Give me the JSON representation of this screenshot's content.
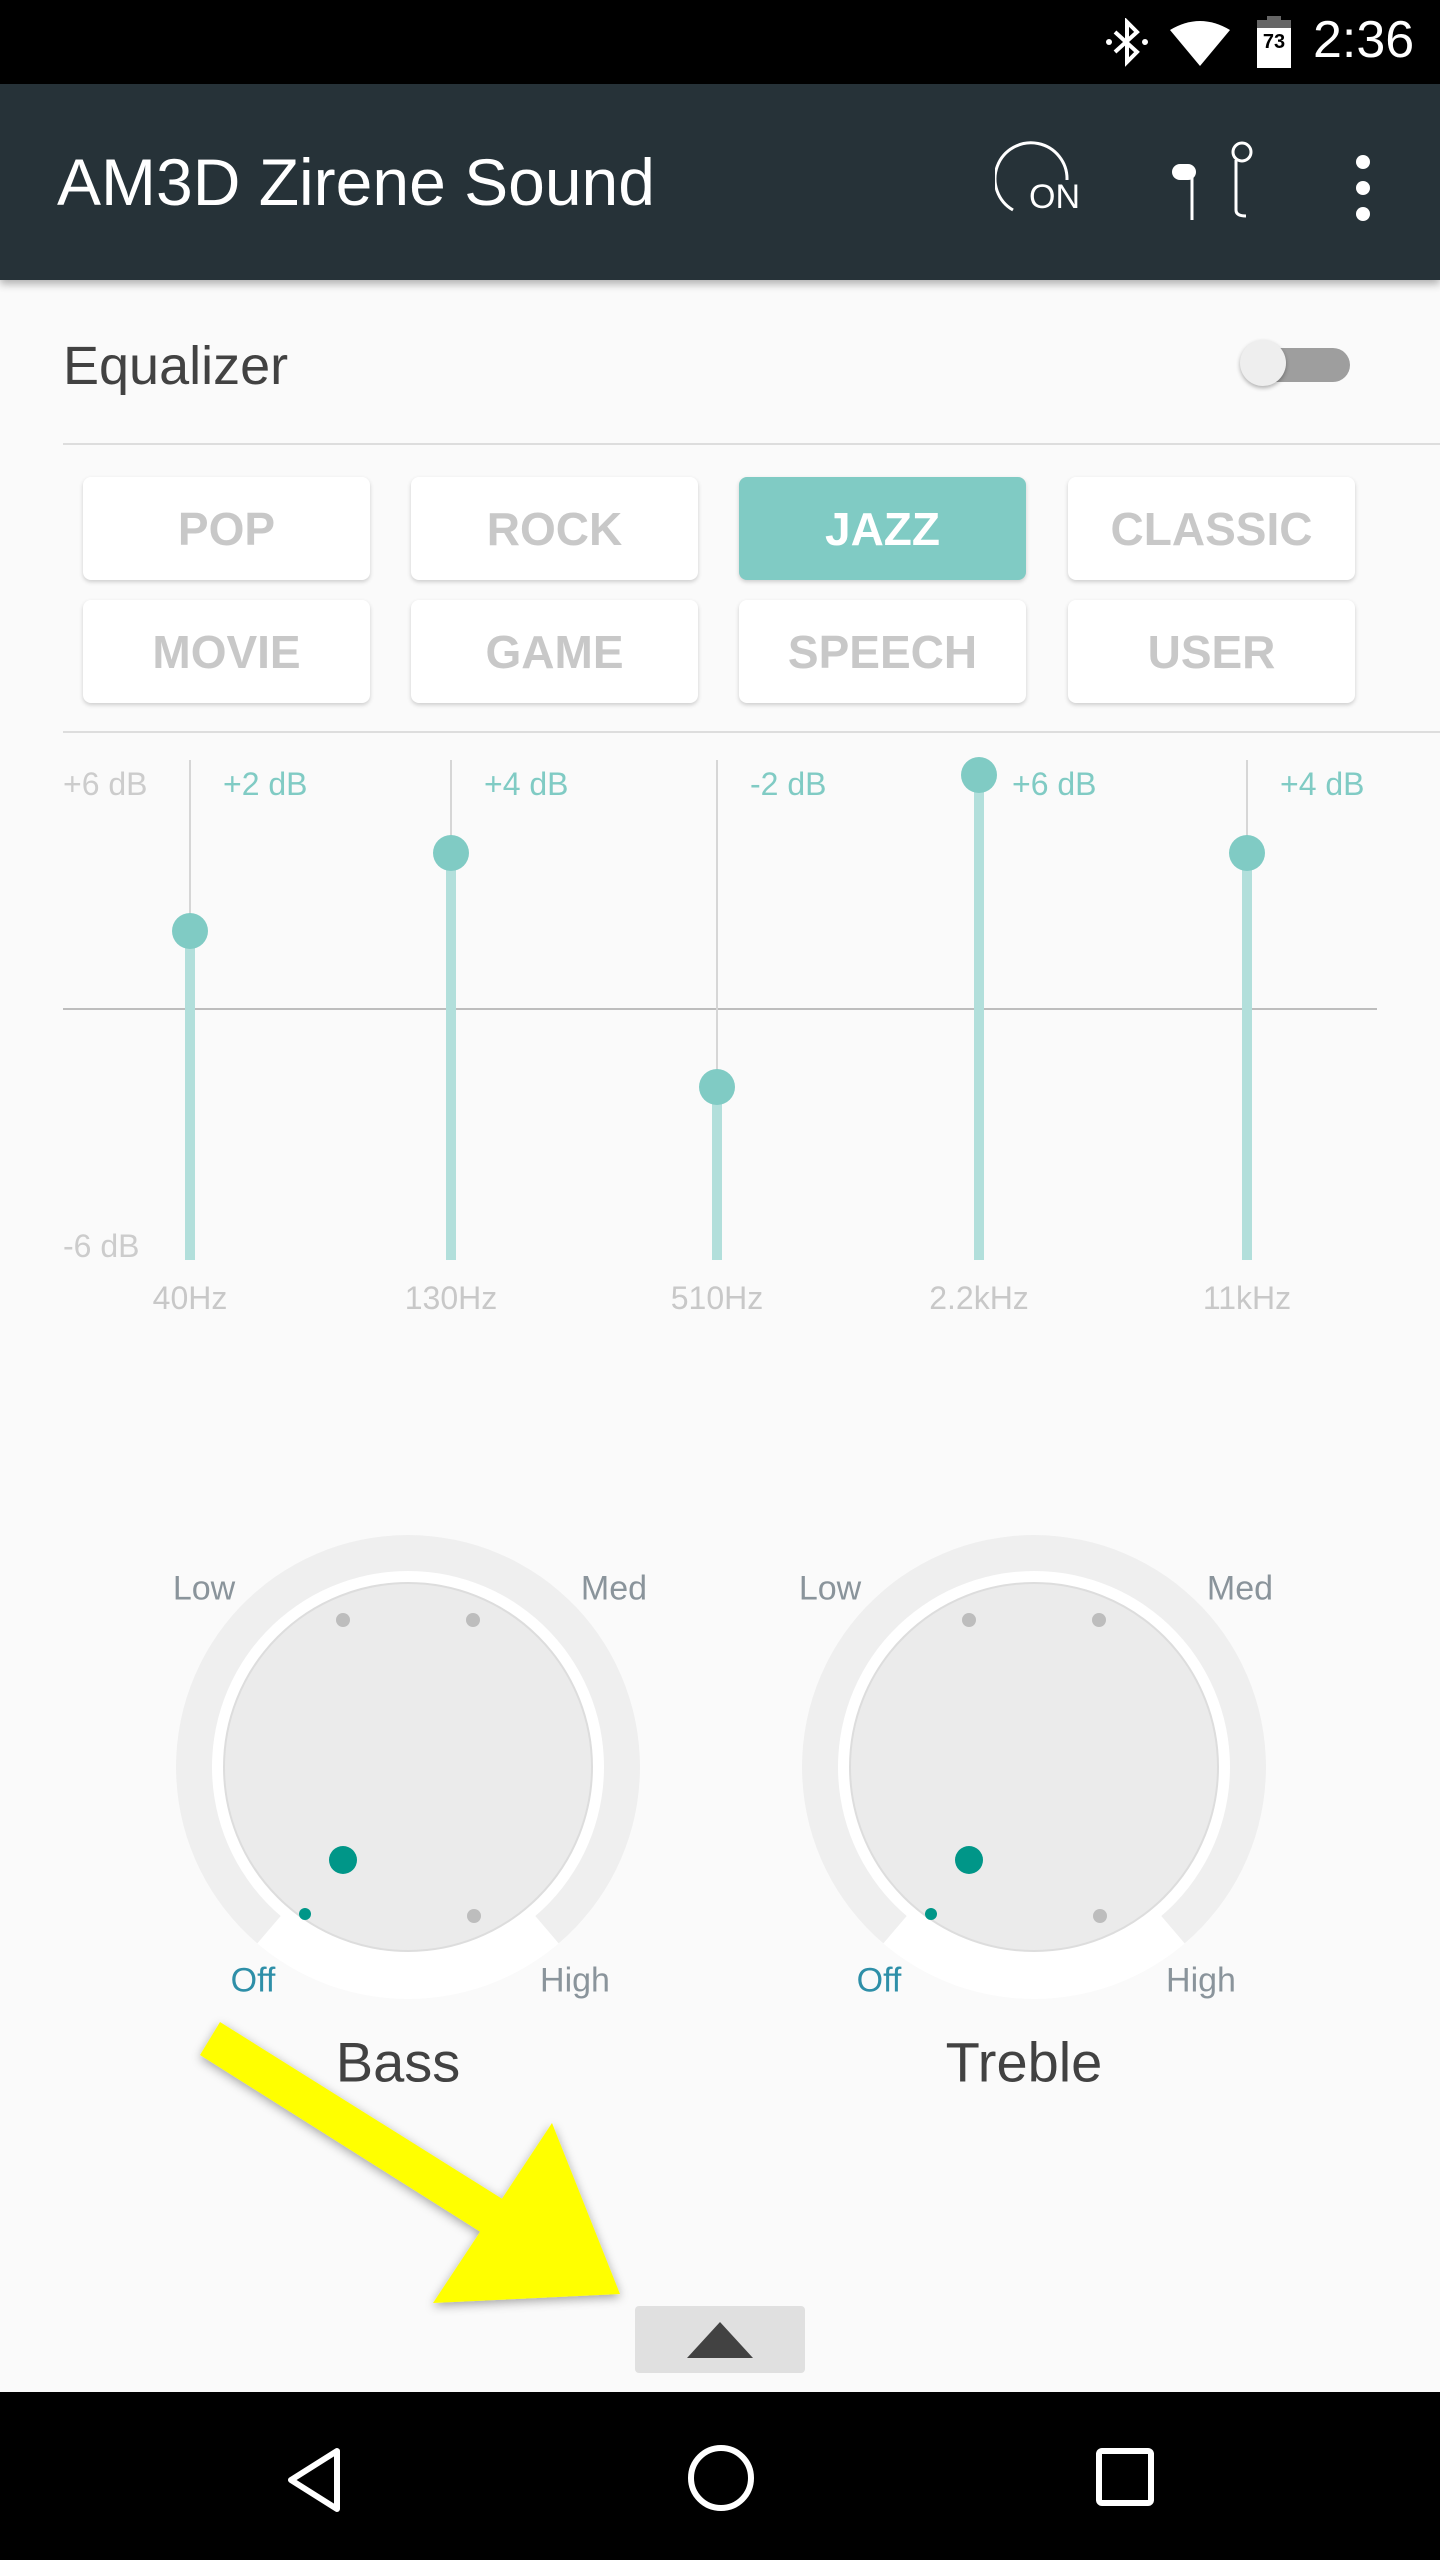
{
  "status_bar": {
    "time": "2:36",
    "battery": "73",
    "icons": [
      "bluetooth-icon",
      "wifi-icon",
      "battery-icon"
    ]
  },
  "toolbar": {
    "title": "AM3D Zirene Sound",
    "power_label": "ON",
    "icons": [
      "power-on-icon",
      "earphones-icon",
      "more-vert-icon"
    ]
  },
  "equalizer": {
    "label": "Equalizer",
    "enabled": false,
    "presets": [
      {
        "label": "POP"
      },
      {
        "label": "ROCK"
      },
      {
        "label": "JAZZ",
        "active": true
      },
      {
        "label": "CLASSIC"
      },
      {
        "label": "MOVIE"
      },
      {
        "label": "GAME"
      },
      {
        "label": "SPEECH"
      },
      {
        "label": "USER"
      }
    ],
    "axis_max": "+6 dB",
    "axis_min": "-6 dB",
    "bands": [
      {
        "freq": "40Hz",
        "value_label": "+2 dB",
        "value": 2
      },
      {
        "freq": "130Hz",
        "value_label": "+4 dB",
        "value": 4
      },
      {
        "freq": "510Hz",
        "value_label": "-2 dB",
        "value": -2
      },
      {
        "freq": "2.2kHz",
        "value_label": "+6 dB",
        "value": 6
      },
      {
        "freq": "11kHz",
        "value_label": "+4 dB",
        "value": 4
      }
    ]
  },
  "knobs": [
    {
      "name": "Bass",
      "level": "Off",
      "labels": {
        "low": "Low",
        "med": "Med",
        "off": "Off",
        "high": "High"
      }
    },
    {
      "name": "Treble",
      "level": "Off",
      "labels": {
        "low": "Low",
        "med": "Med",
        "off": "Off",
        "high": "High"
      }
    }
  ],
  "colors": {
    "accent": "#80cbc4",
    "teal": "#009688",
    "toolbar": "#263238",
    "annotation": "#ffff00"
  },
  "bottom": {
    "expand_icon": "triangle-up-icon"
  },
  "nav": {
    "icons": [
      "back-icon",
      "home-icon",
      "recents-icon"
    ]
  }
}
